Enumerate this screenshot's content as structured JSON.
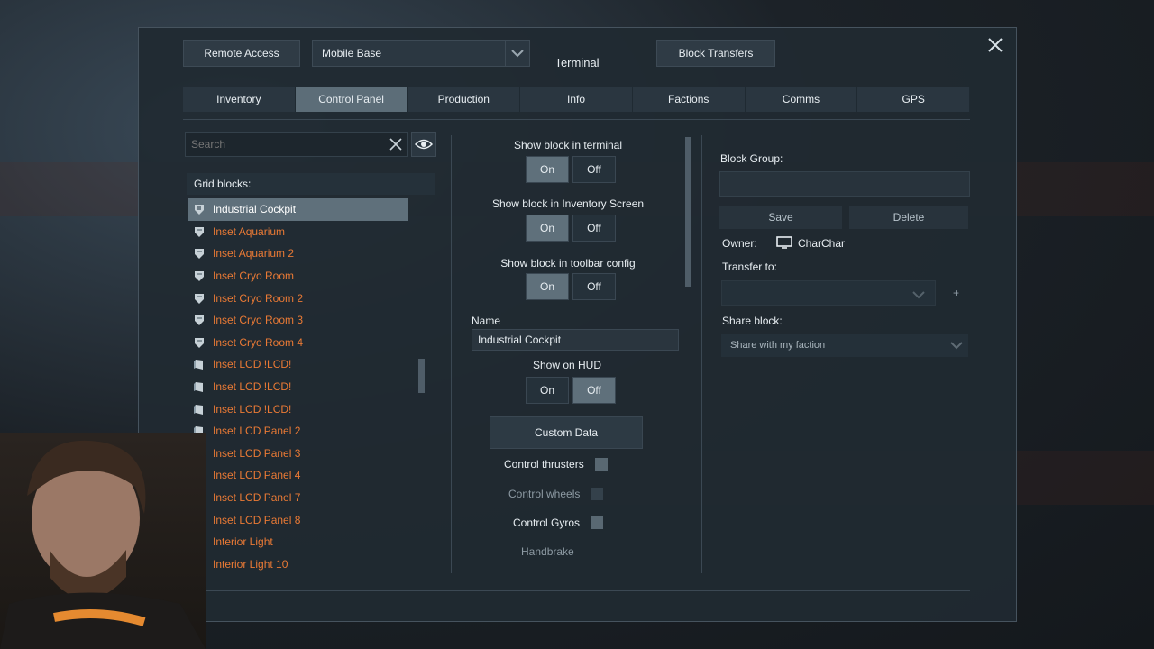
{
  "header": {
    "remote_access": "Remote Access",
    "grid_select": "Mobile Base",
    "title": "Terminal",
    "block_transfers": "Block Transfers"
  },
  "tabs": [
    {
      "label": "Inventory",
      "active": false
    },
    {
      "label": "Control Panel",
      "active": true
    },
    {
      "label": "Production",
      "active": false
    },
    {
      "label": "Info",
      "active": false
    },
    {
      "label": "Factions",
      "active": false
    },
    {
      "label": "Comms",
      "active": false
    },
    {
      "label": "GPS",
      "active": false
    }
  ],
  "left": {
    "search_placeholder": "Search",
    "grid_blocks_label": "Grid blocks:",
    "blocks": [
      {
        "label": "Industrial Cockpit",
        "icon": "cockpit-icon",
        "selected": true
      },
      {
        "label": "Inset Aquarium",
        "icon": "shield-block-icon",
        "selected": false
      },
      {
        "label": "Inset Aquarium 2",
        "icon": "shield-block-icon",
        "selected": false
      },
      {
        "label": "Inset Cryo Room",
        "icon": "shield-block-icon",
        "selected": false
      },
      {
        "label": "Inset Cryo Room 2",
        "icon": "shield-block-icon",
        "selected": false
      },
      {
        "label": "Inset Cryo Room 3",
        "icon": "shield-block-icon",
        "selected": false
      },
      {
        "label": "Inset Cryo Room 4",
        "icon": "shield-block-icon",
        "selected": false
      },
      {
        "label": "Inset LCD !LCD!",
        "icon": "lcd-icon",
        "selected": false
      },
      {
        "label": "Inset LCD !LCD!",
        "icon": "lcd-icon",
        "selected": false
      },
      {
        "label": "Inset LCD !LCD!",
        "icon": "lcd-icon",
        "selected": false
      },
      {
        "label": "Inset LCD Panel 2",
        "icon": "lcd-icon",
        "selected": false
      },
      {
        "label": "Inset LCD Panel 3",
        "icon": "lcd-icon",
        "selected": false
      },
      {
        "label": "Inset LCD Panel 4",
        "icon": "lcd-icon",
        "selected": false
      },
      {
        "label": "Inset LCD Panel 7",
        "icon": "lcd-icon",
        "selected": false
      },
      {
        "label": "Inset LCD Panel 8",
        "icon": "lcd-icon",
        "selected": false
      },
      {
        "label": "Interior Light",
        "icon": "light-icon",
        "selected": false
      },
      {
        "label": "Interior Light 10",
        "icon": "light-icon",
        "selected": false
      }
    ]
  },
  "middle": {
    "show_terminal": "Show block in terminal",
    "show_inventory": "Show block in Inventory Screen",
    "show_toolbar": "Show block in toolbar config",
    "on": "On",
    "off": "Off",
    "name_label": "Name",
    "name_value": "Industrial Cockpit",
    "show_hud": "Show on HUD",
    "custom_data": "Custom Data",
    "control_thrusters": "Control thrusters",
    "control_wheels": "Control wheels",
    "control_gyros": "Control Gyros",
    "handbrake": "Handbrake"
  },
  "right": {
    "block_group": "Block Group:",
    "save": "Save",
    "delete": "Delete",
    "owner_label": "Owner:",
    "owner_name": "CharChar",
    "transfer_label": "Transfer to:",
    "plus": "+",
    "share_label": "Share block:",
    "share_value": "Share with my faction"
  },
  "colors": {
    "accent_orange": "#ea7a35",
    "selected_bg": "#5f707b",
    "panel_bg": "#202a32"
  }
}
